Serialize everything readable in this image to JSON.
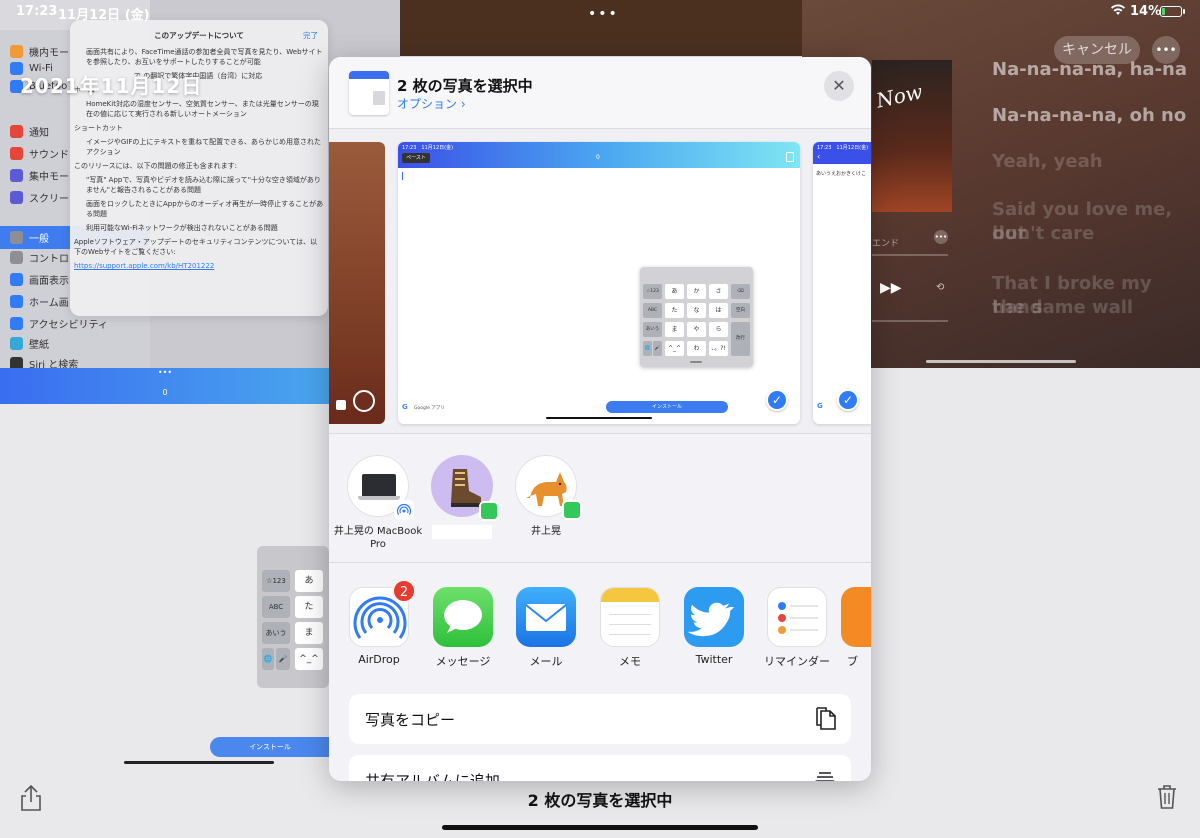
{
  "status_bar": {
    "time": "17:23",
    "date": "11月12日 (金)",
    "battery_text": "14%",
    "battery_fill": 0.14
  },
  "background": {
    "date_big": "2021年11月12日",
    "sidebar_items": [
      "機内モー",
      "Wi-Fi",
      "Bluetoo",
      "通知",
      "サウンド",
      "集中モー",
      "スクリー",
      "一般",
      "コントロ",
      "画面表示",
      "ホーム画",
      "アクセシビリティ",
      "壁紙",
      "Siri と検索"
    ],
    "update_panel": {
      "title": "このアップデートについて",
      "done": "完了",
      "lines": [
        "画面共有により、FaceTime通話の参加者全員で写真を見たり、Webサイトを参照したり、お互いをサポートしたりすることが可能",
        "で の翻訳で繁体字中国語（台湾）に対応",
        "ホーム",
        "HomeKit対応の湿度センサー、空気質センサー、または光量センサーの現在の値に応じて実行される新しいオートメーション",
        "ショートカット",
        "イメージやGIFの上にテキストを重ねて配置できる、あらかじめ用意されたアクション",
        "このリリースには、以下の問題の修正も含まれます:",
        "\"写真\" Appで、写真やビデオを読み込む際に誤って\"十分な空き領域がありません\"と報告されることがある問題",
        "画面をロックしたときにAppからのオーディオ再生が一時停止することがある問題",
        "利用可能なWi-Fiネットワークが検出されないことがある問題",
        "Appleソフトウェア・アップデートのセキュリティコンテンツについては、以下のWebサイトをご覧ください:"
      ],
      "link": "https://support.apple.com/kb/HT201222"
    },
    "music": {
      "cancel": "キャンセル",
      "more": "•••",
      "end_label": "エンド",
      "lyrics_active": [
        "Na-na-na-na, ha-na",
        "Na-na-na-na, oh no"
      ],
      "lyrics_dim": [
        "Yeah, yeah",
        "Said you love me, but",
        "don't care",
        "That I broke my hand",
        "the same wall"
      ]
    },
    "bluebar_number": "0",
    "bluebar_dots": "•••",
    "keyboard_keys": [
      "☆123",
      "あ",
      "ABC",
      "た",
      "あいう",
      "ま",
      "^_^"
    ],
    "install_label": "インストール"
  },
  "sheet": {
    "title": "2 枚の写真を選択中",
    "options": "オプション",
    "close_icon": "close-icon",
    "preview": {
      "status_text": "17:23　11月12日(金)",
      "paste_label": "ペースト",
      "counter": "0",
      "keyboard": [
        "☆123",
        "あ",
        "か",
        "さ",
        "⌫",
        "ABC",
        "た",
        "な",
        "は",
        "空白",
        "あいう",
        "ま",
        "や",
        "ら",
        "改行",
        "🌐",
        "🎤",
        "^_^",
        "わ",
        "、。?!"
      ],
      "google_label": "Google アプリ",
      "install_label": "インストール",
      "right_text": "あいうえおかきくけこ"
    },
    "people": [
      {
        "name": "井上晃の MacBook Pro",
        "badge": "airdrop"
      },
      {
        "name": "",
        "badge": "messages"
      },
      {
        "name": "井上晃",
        "badge": "messages"
      }
    ],
    "apps": [
      {
        "label": "AirDrop",
        "icon": "airdrop-icon",
        "badge": "2"
      },
      {
        "label": "メッセージ",
        "icon": "messages-icon"
      },
      {
        "label": "メール",
        "icon": "mail-icon"
      },
      {
        "label": "メモ",
        "icon": "notes-icon"
      },
      {
        "label": "Twitter",
        "icon": "twitter-icon"
      },
      {
        "label": "リマインダー",
        "icon": "reminders-icon"
      },
      {
        "label": "ブ",
        "icon": "books-icon"
      }
    ],
    "actions": [
      {
        "label": "写真をコピー",
        "icon": "copy-icon"
      },
      {
        "label": "共有アルバムに追加",
        "icon": "shared-album-icon"
      }
    ]
  },
  "bottom": {
    "title": "2 枚の写真を選択中"
  },
  "colors": {
    "accent": "#2f7cf6",
    "badge_red": "#e63b30"
  }
}
